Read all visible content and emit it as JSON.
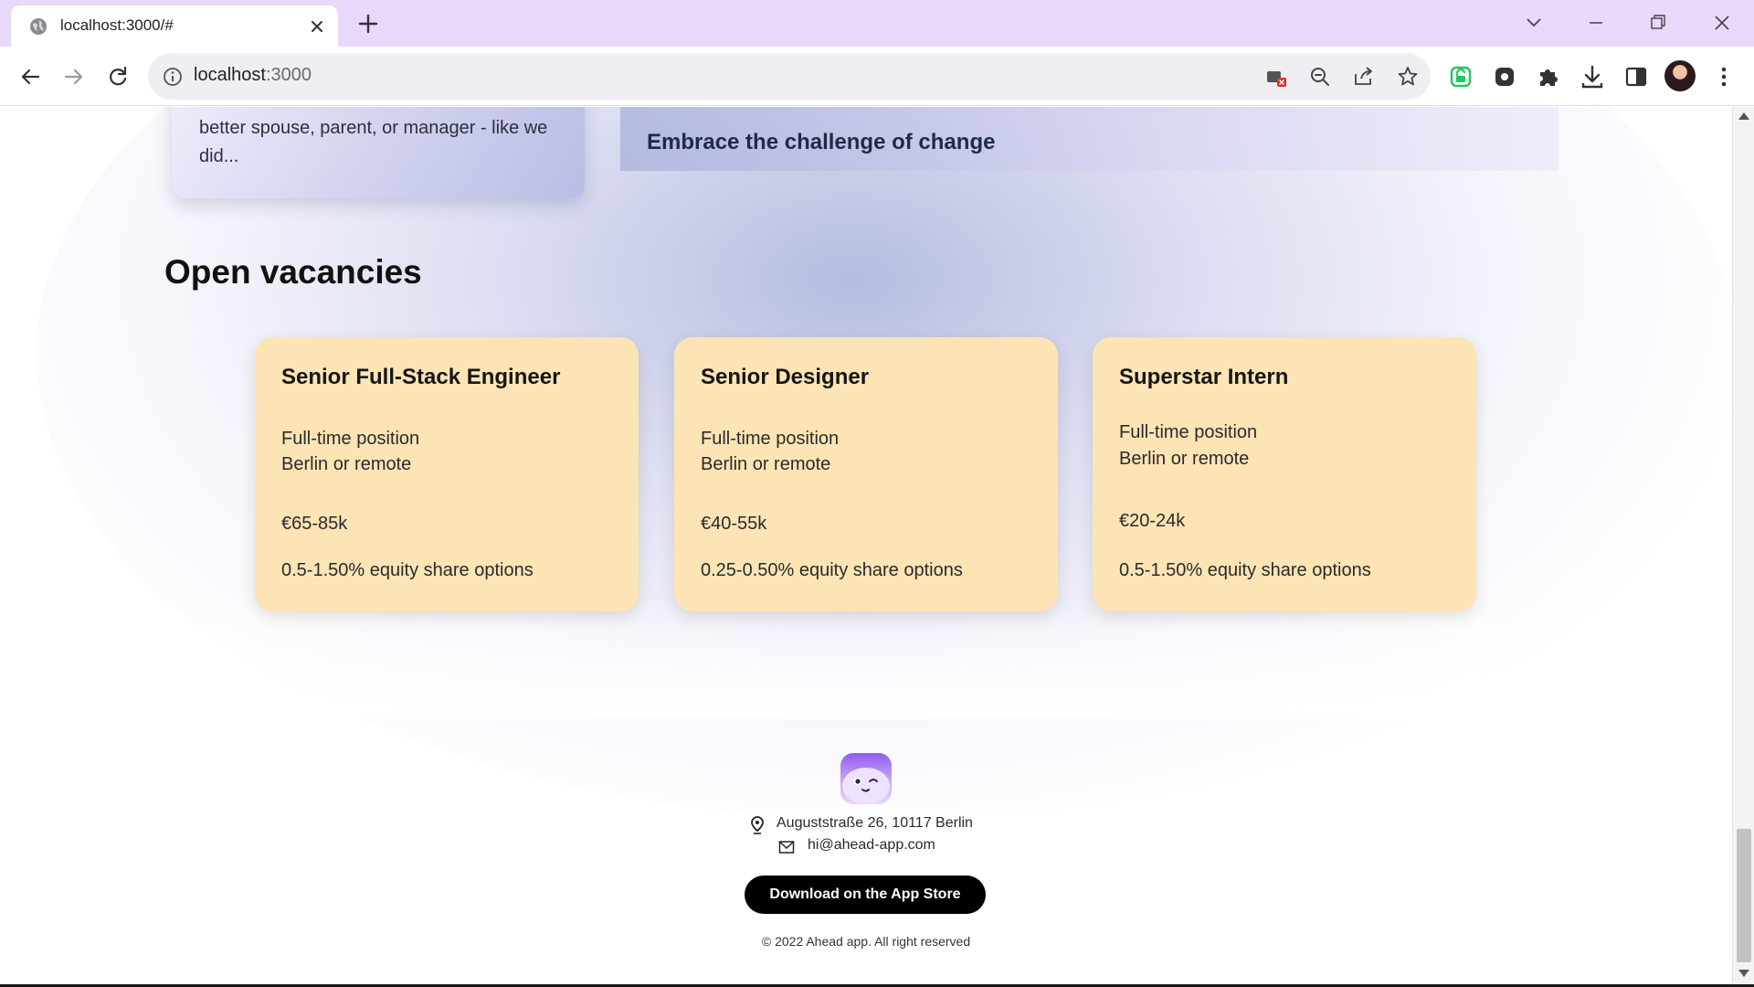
{
  "browser": {
    "tab_title": "localhost:3000/#",
    "url_host": "localhost",
    "url_port": ":3000"
  },
  "page": {
    "previous_card_text": "better spouse, parent, or manager - like we did...",
    "previous_banner_title": "Embrace the challenge of change",
    "section_heading": "Open vacancies",
    "vacancies": [
      {
        "title": "Senior Full-Stack Engineer",
        "type": "Full-time position",
        "location": "Berlin or remote",
        "salary": "€65-85k",
        "equity": "0.5-1.50% equity share options"
      },
      {
        "title": "Senior Designer",
        "type": "Full-time position",
        "location": "Berlin or remote",
        "salary": "€40-55k",
        "equity": "0.25-0.50% equity share options"
      },
      {
        "title": "Superstar Intern",
        "type": "Full-time position",
        "location": "Berlin or remote",
        "salary": "€20-24k",
        "equity": "0.5-1.50% equity share options"
      }
    ]
  },
  "footer": {
    "address": "Auguststraße 26, 10117 Berlin",
    "email": "hi@ahead-app.com",
    "app_store_button": "Download on the App Store",
    "copyright": "© 2022 Ahead app. All right reserved"
  },
  "colors": {
    "card_background": "#fde4b5",
    "tabstrip": "#e8d9fb",
    "logo_accent": "#8f5cf0"
  }
}
